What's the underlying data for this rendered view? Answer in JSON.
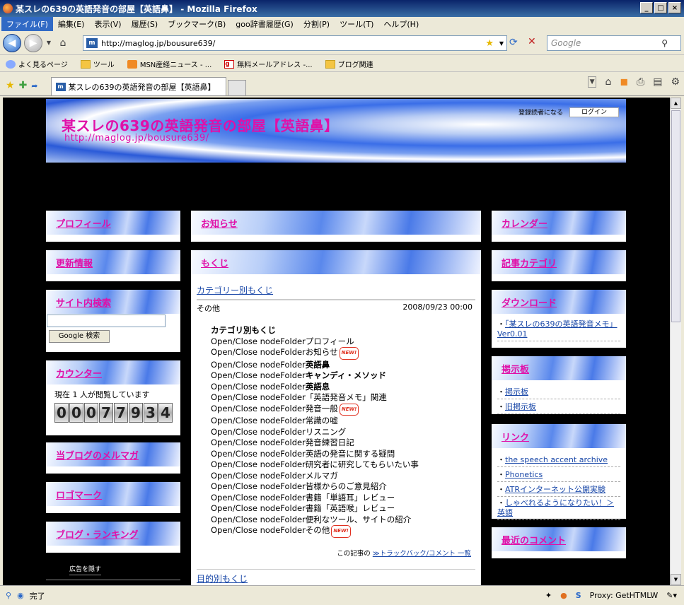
{
  "window": {
    "title": "某スレの639の英語発音の部屋【英語鼻】 - Mozilla Firefox"
  },
  "menu": [
    "ファイル(F)",
    "編集(E)",
    "表示(V)",
    "履歴(S)",
    "ブックマーク(B)",
    "goo辞書履歴(G)",
    "分割(P)",
    "ツール(T)",
    "ヘルプ(H)"
  ],
  "nav": {
    "url": "http://maglog.jp/bousure639/",
    "search_placeholder": "Google"
  },
  "bookmarks": [
    "よく見るページ",
    "ツール",
    "MSN産経ニュース - ...",
    "無料メールアドレス -...",
    "ブログ関連"
  ],
  "tab": {
    "label": "某スレの639の英語発音の部屋【英語鼻】"
  },
  "status": {
    "text": "完了",
    "proxy": "Proxy: GetHTMLW"
  },
  "blog": {
    "title": "某スレの639の英語発音の部屋【英語鼻】",
    "url": "http://maglog.jp/bousure639/",
    "register": "登録読者になる",
    "login": "ログイン"
  },
  "left": {
    "profile": "プロフィール",
    "updates": "更新情報",
    "site_search": "サイト内検索",
    "google_btn": "Google 検索",
    "counter_title": "カウンター",
    "online": "現在 1 人が閲覧しています",
    "counter_digits": [
      "0",
      "0",
      "0",
      "7",
      "7",
      "9",
      "3",
      "4"
    ],
    "mailmag": "当ブログのメルマガ",
    "logo": "ロゴマーク",
    "ranking": "ブログ・ランキング",
    "hide_ads": "広告を隠す"
  },
  "center": {
    "news": "お知らせ",
    "toc": "もくじ",
    "cat_toc": "カテゴリー別もくじ",
    "category": "その他",
    "date": "2008/09/23 00:00",
    "list_title": "カテゴリ別もくじ",
    "items": [
      {
        "prefix": "Open/Close nodeFolder",
        "text": "プロフィール",
        "bold": false,
        "new": false
      },
      {
        "prefix": "Open/Close nodeFolder",
        "text": "お知らせ",
        "bold": false,
        "new": true
      },
      {
        "prefix": "Open/Close nodeFolder",
        "text": "英語鼻",
        "bold": true,
        "new": false
      },
      {
        "prefix": "Open/Close nodeFolder",
        "text": "キャンディ・メソッド",
        "bold": true,
        "new": false
      },
      {
        "prefix": "Open/Close nodeFolder",
        "text": "英語息",
        "bold": true,
        "new": false
      },
      {
        "prefix": "Open/Close nodeFolder",
        "text": "「英語発音メモ」関連",
        "bold": false,
        "new": false
      },
      {
        "prefix": "Open/Close nodeFolder",
        "text": "発音一般",
        "bold": false,
        "new": true
      },
      {
        "prefix": "Open/Close nodeFolder",
        "text": "常識の嘘",
        "bold": false,
        "new": false
      },
      {
        "prefix": "Open/Close nodeFolder",
        "text": "リスニング",
        "bold": false,
        "new": false
      },
      {
        "prefix": "Open/Close nodeFolder",
        "text": "発音練習日記",
        "bold": false,
        "new": false
      },
      {
        "prefix": "Open/Close nodeFolder",
        "text": "英語の発音に関する疑問",
        "bold": false,
        "new": false
      },
      {
        "prefix": "Open/Close nodeFolder",
        "text": "研究者に研究してもらいたい事",
        "bold": false,
        "new": false
      },
      {
        "prefix": "Open/Close nodeFolder",
        "text": "メルマガ",
        "bold": false,
        "new": false
      },
      {
        "prefix": "Open/Close nodeFolder",
        "text": "皆様からのご意見紹介",
        "bold": false,
        "new": false
      },
      {
        "prefix": "Open/Close nodeFolder",
        "text": "書籍「単語耳」レビュー",
        "bold": false,
        "new": false
      },
      {
        "prefix": "Open/Close nodeFolder",
        "text": "書籍「英語喉」レビュー",
        "bold": false,
        "new": false
      },
      {
        "prefix": "Open/Close nodeFolder",
        "text": "便利なツール、サイトの紹介",
        "bold": false,
        "new": false
      },
      {
        "prefix": "Open/Close nodeFolder",
        "text": "その他",
        "bold": false,
        "new": true
      }
    ],
    "new_badge": "NEW!",
    "article_prefix": "この記事の",
    "trackback": "≫トラックバック/コメント 一覧",
    "purpose_toc": "目的別もくじ"
  },
  "right": {
    "calendar": "カレンダー",
    "categories": "記事カテゴリ",
    "download": "ダウンロード",
    "download_item": "「某スレの639の英語発音メモ」Ver0.01",
    "bbs": "掲示板",
    "bbs_items": [
      "掲示板",
      "旧掲示板"
    ],
    "links": "リンク",
    "link_items": [
      "the speech accent archive",
      "Phonetics",
      "ATRインターネット公開実験",
      "しゃべれるようになりたい！＞英語"
    ],
    "recent_comments": "最近のコメント"
  }
}
